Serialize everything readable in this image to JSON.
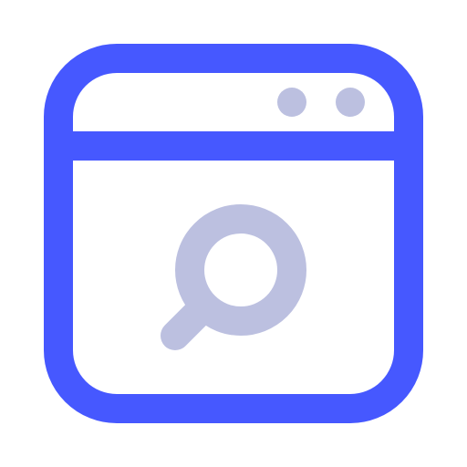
{
  "icon": {
    "name": "browser-search-icon",
    "colors": {
      "frame": "#4658FF",
      "accent": "#BCC0E0",
      "background": "#FFFFFF"
    },
    "parts": [
      "window-frame",
      "title-bar-divider",
      "window-dot",
      "window-dot",
      "magnifier"
    ]
  }
}
